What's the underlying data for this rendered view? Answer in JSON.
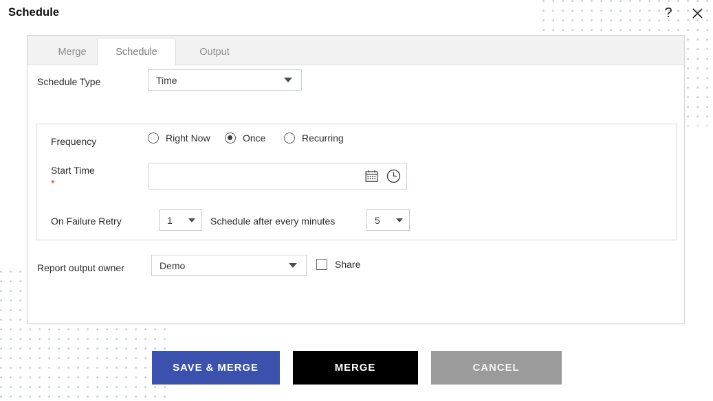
{
  "header": {
    "title": "Schedule",
    "help_icon": "question-mark-help-icon",
    "close_icon": "close-x-icon"
  },
  "tabs": [
    {
      "id": "merge",
      "label": "Merge",
      "active": false
    },
    {
      "id": "schedule",
      "label": "Schedule",
      "active": true
    },
    {
      "id": "output",
      "label": "Output",
      "active": false
    }
  ],
  "form": {
    "schedule_type": {
      "label": "Schedule Type",
      "value": "Time",
      "options": [
        "Time"
      ]
    },
    "frequency": {
      "label": "Frequency",
      "options": [
        {
          "id": "right-now",
          "label": "Right Now",
          "selected": false
        },
        {
          "id": "once",
          "label": "Once",
          "selected": true
        },
        {
          "id": "recurring",
          "label": "Recurring",
          "selected": false
        }
      ]
    },
    "start_time": {
      "label": "Start Time",
      "required_marker": "*",
      "value": "",
      "placeholder": "",
      "calendar_icon": "calendar-icon",
      "clock_icon": "clock-icon"
    },
    "retry": {
      "label": "On Failure Retry",
      "count_value": "1",
      "middle_label": "Schedule after every minutes",
      "minutes_value": "5"
    },
    "report_output_owner": {
      "label": "Report output owner",
      "value": "Demo",
      "options": [
        "Demo"
      ]
    },
    "share": {
      "label": "Share",
      "checked": false
    }
  },
  "footer": {
    "buttons": [
      {
        "id": "save-merge",
        "label": "SAVE & MERGE",
        "color": "#3a52ad"
      },
      {
        "id": "merge",
        "label": "MERGE",
        "color": "#000000"
      },
      {
        "id": "cancel",
        "label": "CANCEL",
        "color": "#9b9b9b"
      }
    ]
  },
  "decoration": {
    "dot_color": "#8e9ddb"
  }
}
